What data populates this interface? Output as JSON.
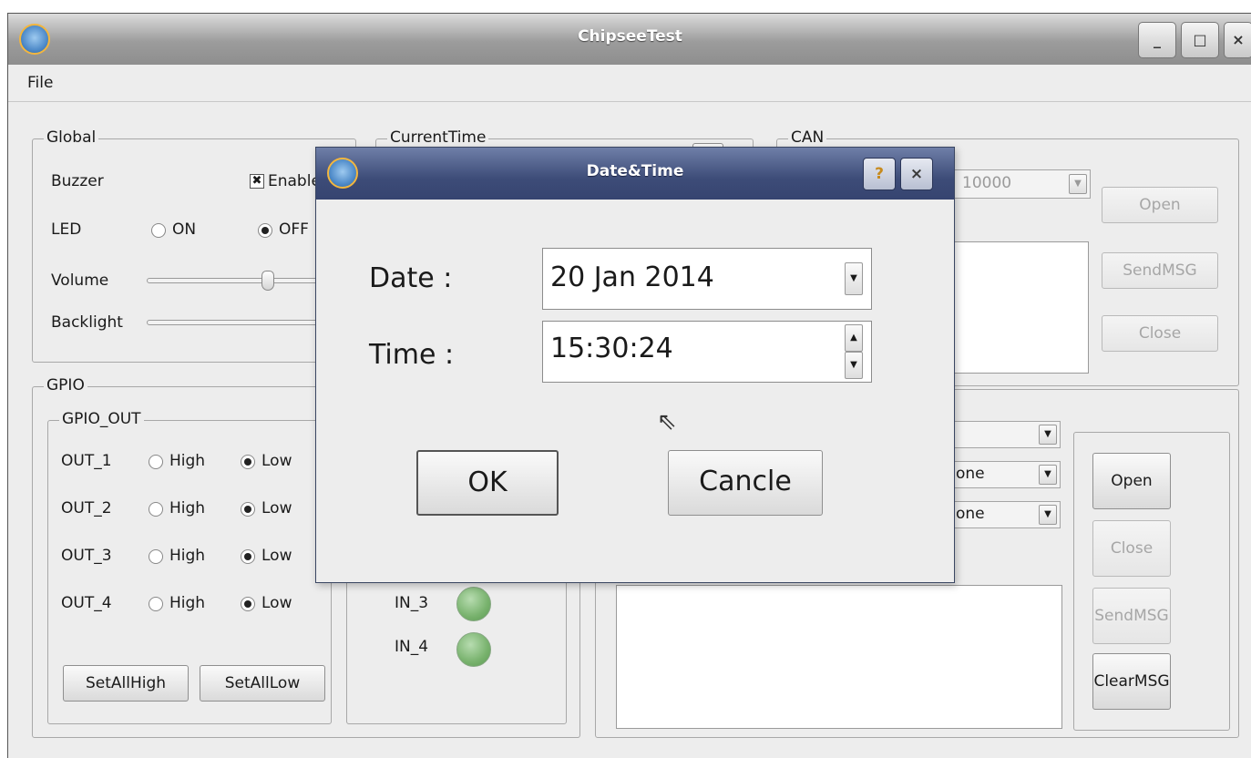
{
  "window": {
    "title": "ChipseeTest",
    "buttons": {
      "minimize": "_",
      "maximize": "□",
      "close": "×"
    }
  },
  "menu": {
    "file": "File"
  },
  "global": {
    "title": "Global",
    "buzzer_label": "Buzzer",
    "buzzer_checkbox": "Enable",
    "buzzer_checked": true,
    "led_label": "LED",
    "led_on": "ON",
    "led_off": "OFF",
    "led_state": "OFF",
    "volume_label": "Volume",
    "backlight_label": "Backlight"
  },
  "current_time": {
    "title": "CurrentTime"
  },
  "can": {
    "title": "CAN",
    "bitrate": "10000",
    "open": "Open",
    "sendmsg": "SendMSG",
    "close": "Close"
  },
  "gpio": {
    "title": "GPIO",
    "out_title": "GPIO_OUT",
    "outputs": [
      {
        "name": "OUT_1",
        "high": "High",
        "low": "Low",
        "state": "Low"
      },
      {
        "name": "OUT_2",
        "high": "High",
        "low": "Low",
        "state": "Low"
      },
      {
        "name": "OUT_3",
        "high": "High",
        "low": "Low",
        "state": "Low"
      },
      {
        "name": "OUT_4",
        "high": "High",
        "low": "Low",
        "state": "Low"
      }
    ],
    "set_all_high": "SetAllHigh",
    "set_all_low": "SetAllLow",
    "inputs": [
      {
        "name": "IN_3"
      },
      {
        "name": "IN_4"
      }
    ]
  },
  "serial": {
    "combo1": "",
    "combo2": "one",
    "combo3": "one",
    "open": "Open",
    "close": "Close",
    "sendmsg": "SendMSG",
    "clearmsg": "ClearMSG"
  },
  "dialog": {
    "title": "Date&Time",
    "help": "?",
    "close": "×",
    "date_label": "Date :",
    "date_value": "20 Jan 2014",
    "time_label": "Time :",
    "time_value": "15:30:24",
    "ok": "OK",
    "cancel": "Cancle"
  },
  "colors": {
    "dialog_title": "#3d4c78",
    "window_title": "#9c9c9c",
    "led_green": "#78b26d"
  }
}
